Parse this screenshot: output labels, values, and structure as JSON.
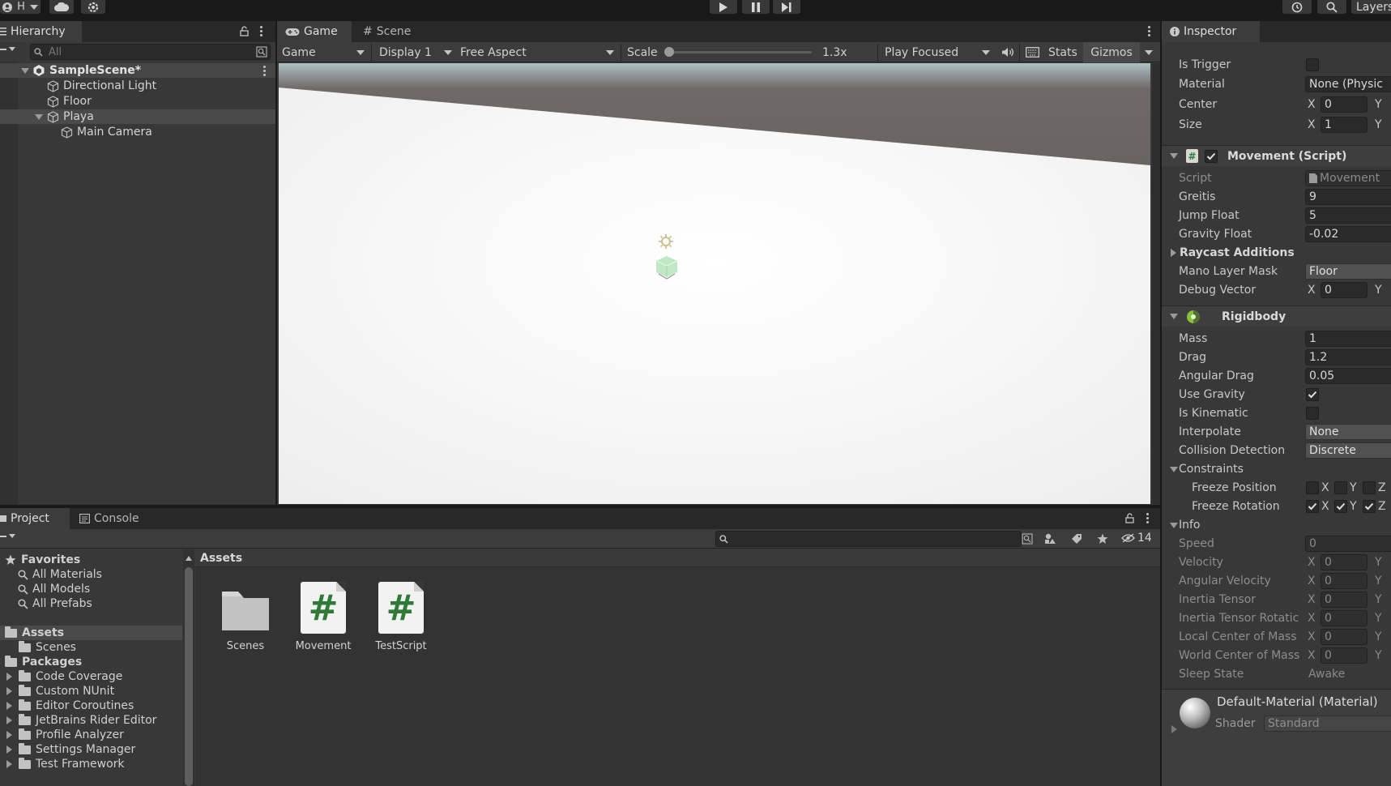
{
  "toolbar": {
    "account_label": "H",
    "layers_label": "Layers"
  },
  "hierarchy": {
    "tab_label": "Hierarchy",
    "search_placeholder": "All",
    "scene_name": "SampleScene*",
    "items": [
      {
        "label": "Directional Light"
      },
      {
        "label": "Floor"
      },
      {
        "label": "Playa"
      },
      {
        "label": "Main Camera"
      }
    ]
  },
  "game_view": {
    "tabs": [
      {
        "label": "Game"
      },
      {
        "label": "Scene"
      }
    ],
    "mode_select": "Game",
    "display_select": "Display 1",
    "aspect_select": "Free Aspect",
    "scale_label": "Scale",
    "scale_value": "1.3x",
    "play_mode_select": "Play Focused",
    "stats_label": "Stats",
    "gizmos_label": "Gizmos"
  },
  "inspector": {
    "tab_label": "Inspector",
    "collider": {
      "is_trigger_label": "Is Trigger",
      "material_label": "Material",
      "material_value": "None (Physic",
      "center_label": "Center",
      "center_x": "0",
      "size_label": "Size",
      "size_x": "1"
    },
    "movement": {
      "title": "Movement (Script)",
      "script_label": "Script",
      "script_value": "Movement",
      "greitis_label": "Greitis",
      "greitis_value": "9",
      "jump_label": "Jump Float",
      "jump_value": "5",
      "gravity_label": "Gravity Float",
      "gravity_value": "-0.02",
      "raycast_label": "Raycast Additions",
      "mask_label": "Mano Layer Mask",
      "mask_value": "Floor",
      "debug_label": "Debug Vector",
      "debug_x": "0"
    },
    "rigidbody": {
      "title": "Rigidbody",
      "mass_label": "Mass",
      "mass_value": "1",
      "drag_label": "Drag",
      "drag_value": "1.2",
      "angular_drag_label": "Angular Drag",
      "angular_drag_value": "0.05",
      "use_gravity_label": "Use Gravity",
      "is_kinematic_label": "Is Kinematic",
      "interpolate_label": "Interpolate",
      "interpolate_value": "None",
      "collision_label": "Collision Detection",
      "collision_value": "Discrete",
      "constraints_label": "Constraints",
      "freeze_position_label": "Freeze Position",
      "freeze_rotation_label": "Freeze Rotation",
      "info_label": "Info",
      "speed_label": "Speed",
      "speed_value": "0",
      "velocity_label": "Velocity",
      "angular_velocity_label": "Angular Velocity",
      "inertia_tensor_label": "Inertia Tensor",
      "inertia_rotation_label": "Inertia Tensor Rotatic",
      "local_com_label": "Local Center of Mass",
      "world_com_label": "World Center of Mass",
      "zero": "0",
      "sleep_label": "Sleep State",
      "sleep_value": "Awake"
    },
    "material": {
      "title": "Default-Material (Material)",
      "shader_label": "Shader",
      "shader_value": "Standard"
    },
    "axis": {
      "x": "X",
      "y": "Y",
      "z": "Z"
    }
  },
  "project": {
    "tabs": [
      {
        "label": "Project"
      },
      {
        "label": "Console"
      }
    ],
    "hidden_count": "14",
    "favorites_label": "Favorites",
    "favorites": [
      {
        "label": "All Materials"
      },
      {
        "label": "All Models"
      },
      {
        "label": "All Prefabs"
      }
    ],
    "assets_label": "Assets",
    "asset_children": [
      {
        "label": "Scenes"
      }
    ],
    "packages_label": "Packages",
    "packages": [
      {
        "label": "Code Coverage"
      },
      {
        "label": "Custom NUnit"
      },
      {
        "label": "Editor Coroutines"
      },
      {
        "label": "JetBrains Rider Editor"
      },
      {
        "label": "Profile Analyzer"
      },
      {
        "label": "Settings Manager"
      },
      {
        "label": "Test Framework"
      }
    ],
    "breadcrumb": "Assets",
    "assets": [
      {
        "label": "Scenes"
      },
      {
        "label": "Movement"
      },
      {
        "label": "TestScript"
      }
    ]
  }
}
